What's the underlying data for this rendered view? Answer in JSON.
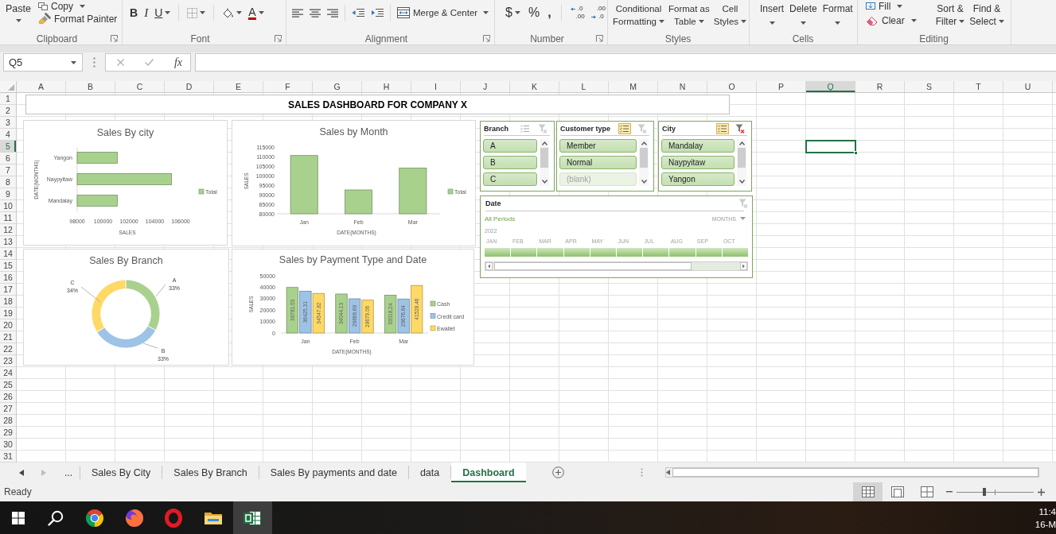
{
  "ribbon": {
    "clipboard": {
      "label": "Clipboard",
      "launcher": true,
      "paste": "Paste",
      "copy": "Copy",
      "format_painter": "Format Painter"
    },
    "font": {
      "label": "Font",
      "launcher": true,
      "bold": "B",
      "italic": "I",
      "underline": "U",
      "font_color": "A"
    },
    "alignment": {
      "label": "Alignment",
      "launcher": true,
      "merge": "Merge & Center"
    },
    "number": {
      "label": "Number",
      "launcher": true,
      "currency": "$",
      "percent": "%",
      "comma": ",",
      "increase_decimal": [
        ".0",
        ".00"
      ],
      "decrease_decimal": [
        ".00",
        ".0"
      ]
    },
    "styles": {
      "label": "Styles",
      "buttons": [
        [
          "Conditional",
          "Formatting"
        ],
        [
          "Format as",
          "Table"
        ],
        [
          "Cell",
          "Styles"
        ]
      ]
    },
    "cells": {
      "label": "Cells",
      "buttons": [
        "Insert",
        "Delete",
        "Format"
      ]
    },
    "editing": {
      "label": "Editing",
      "fill": "Fill",
      "clear": "Clear",
      "buttons": [
        [
          "Sort &",
          "Filter"
        ],
        [
          "Find &",
          "Select"
        ]
      ]
    }
  },
  "formula_bar": {
    "name_box": "Q5",
    "function_button": "fx"
  },
  "sheet": {
    "columns": [
      {
        "label": "A",
        "selected": false
      },
      {
        "label": "B",
        "selected": false
      },
      {
        "label": "C",
        "selected": false
      },
      {
        "label": "D",
        "selected": false
      },
      {
        "label": "E",
        "selected": false
      },
      {
        "label": "F",
        "selected": false
      },
      {
        "label": "G",
        "selected": false
      },
      {
        "label": "H",
        "selected": false
      },
      {
        "label": "I",
        "selected": false
      },
      {
        "label": "J",
        "selected": false
      },
      {
        "label": "K",
        "selected": false
      },
      {
        "label": "L",
        "selected": false
      },
      {
        "label": "M",
        "selected": false
      },
      {
        "label": "N",
        "selected": false
      },
      {
        "label": "O",
        "selected": false
      },
      {
        "label": "P",
        "selected": false
      },
      {
        "label": "Q",
        "selected": true
      },
      {
        "label": "R",
        "selected": false
      },
      {
        "label": "S",
        "selected": false
      },
      {
        "label": "T",
        "selected": false
      },
      {
        "label": "U",
        "selected": false
      }
    ],
    "rows": [
      {
        "label": "1",
        "selected": false
      },
      {
        "label": "2",
        "selected": false
      },
      {
        "label": "3",
        "selected": false
      },
      {
        "label": "4",
        "selected": false
      },
      {
        "label": "5",
        "selected": true
      },
      {
        "label": "6",
        "selected": false
      },
      {
        "label": "7",
        "selected": false
      },
      {
        "label": "8",
        "selected": false
      },
      {
        "label": "9",
        "selected": false
      },
      {
        "label": "10",
        "selected": false
      },
      {
        "label": "11",
        "selected": false
      },
      {
        "label": "12",
        "selected": false
      },
      {
        "label": "13",
        "selected": false
      },
      {
        "label": "14",
        "selected": false
      },
      {
        "label": "15",
        "selected": false
      },
      {
        "label": "16",
        "selected": false
      },
      {
        "label": "17",
        "selected": false
      },
      {
        "label": "18",
        "selected": false
      },
      {
        "label": "19",
        "selected": false
      },
      {
        "label": "20",
        "selected": false
      },
      {
        "label": "21",
        "selected": false
      },
      {
        "label": "22",
        "selected": false
      },
      {
        "label": "23",
        "selected": false
      },
      {
        "label": "24",
        "selected": false
      },
      {
        "label": "25",
        "selected": false
      },
      {
        "label": "26",
        "selected": false
      },
      {
        "label": "27",
        "selected": false
      },
      {
        "label": "28",
        "selected": false
      },
      {
        "label": "29",
        "selected": false
      },
      {
        "label": "30",
        "selected": false
      },
      {
        "label": "31",
        "selected": false
      }
    ],
    "title": "SALES DASHBOARD FOR COMPANY X"
  },
  "charts": [
    {
      "chart_data": {
        "type": "bar",
        "orientation": "horizontal",
        "title": "Sales By city",
        "xlabel": "SALES",
        "ylabel": "DATE(MONTHS)",
        "categories": [
          "Yangon",
          "Naypyitaw",
          "Mandalay"
        ],
        "series": [
          {
            "name": "Total",
            "color": "#a9d18e",
            "values": [
              101100,
              105300,
              101100
            ]
          }
        ],
        "xlim": [
          98000,
          106000
        ],
        "xticks": [
          98000,
          100000,
          102000,
          104000,
          106000
        ],
        "legend": "right"
      }
    },
    {
      "chart_data": {
        "type": "bar",
        "title": "Sales by Month",
        "xlabel": "DATE(MONTHS)",
        "ylabel": "SALES",
        "categories": [
          "Jan",
          "Feb",
          "Mar"
        ],
        "series": [
          {
            "name": "Total",
            "color": "#a9d18e",
            "values": [
              110800,
              92600,
              104200
            ]
          }
        ],
        "ylim": [
          80000,
          115000
        ],
        "yticks": [
          80000,
          85000,
          90000,
          95000,
          100000,
          105000,
          110000,
          115000
        ],
        "legend": "right"
      }
    },
    {
      "chart_data": {
        "type": "donut",
        "title": "Sales By Branch",
        "categories": [
          "A",
          "B",
          "C"
        ],
        "values": [
          33,
          33,
          34
        ],
        "colors": [
          "#a9d18e",
          "#9dc3e6",
          "#ffd966"
        ],
        "value_labels": [
          "33%",
          "33%",
          "34%"
        ]
      }
    },
    {
      "chart_data": {
        "type": "bar",
        "title": "Sales by Payment Type and Date",
        "xlabel": "DATE(MONTHS)",
        "ylabel": "SALES",
        "categories": [
          "Jan",
          "Feb",
          "Mar"
        ],
        "series": [
          {
            "name": "Cash",
            "color": "#a9d18e",
            "values": [
              39781.03,
              34044.13,
              33018.24
            ]
          },
          {
            "name": "Credit card",
            "color": "#9dc3e6",
            "values": [
              36425.31,
              29866.69,
              29676.64
            ]
          },
          {
            "name": "Ewallet",
            "color": "#ffd966",
            "values": [
              34547.82,
              28679.06,
              41528.46
            ]
          }
        ],
        "ylim": [
          0,
          50000
        ],
        "yticks": [
          0,
          10000,
          20000,
          30000,
          40000,
          50000
        ],
        "data_labels": true,
        "legend": "right"
      }
    }
  ],
  "slicers": [
    {
      "title": "Branch",
      "multi_select": false,
      "filtered": false,
      "items": [
        {
          "label": "A",
          "selected": true
        },
        {
          "label": "B",
          "selected": true
        },
        {
          "label": "C",
          "selected": true
        }
      ]
    },
    {
      "title": "Customer type",
      "multi_select": true,
      "filtered": false,
      "items": [
        {
          "label": "Member",
          "selected": true
        },
        {
          "label": "Normal",
          "selected": true
        },
        {
          "label": "(blank)",
          "selected": false
        }
      ]
    },
    {
      "title": "City",
      "multi_select": true,
      "filtered": true,
      "items": [
        {
          "label": "Mandalay",
          "selected": true
        },
        {
          "label": "Naypyitaw",
          "selected": true
        },
        {
          "label": "Yangon",
          "selected": true
        }
      ]
    }
  ],
  "timeline": {
    "title": "Date",
    "filtered": false,
    "period": "All Periods",
    "time_level": "MONTHS",
    "year": "2022",
    "months": [
      {
        "label": "JAN",
        "selected": true
      },
      {
        "label": "FEB",
        "selected": true
      },
      {
        "label": "MAR",
        "selected": true
      },
      {
        "label": "APR",
        "selected": true
      },
      {
        "label": "MAY",
        "selected": true
      },
      {
        "label": "JUN",
        "selected": true
      },
      {
        "label": "JUL",
        "selected": true
      },
      {
        "label": "AUG",
        "selected": true
      },
      {
        "label": "SEP",
        "selected": true
      },
      {
        "label": "OCT",
        "selected": true
      }
    ]
  },
  "sheet_tabs": {
    "more": "...",
    "tabs": [
      {
        "label": "Sales By City",
        "selected": false
      },
      {
        "label": "Sales By Branch",
        "selected": false
      },
      {
        "label": "Sales By payments and date",
        "selected": false
      },
      {
        "label": "data",
        "selected": false
      },
      {
        "label": "Dashboard",
        "selected": true
      }
    ]
  },
  "status_bar": {
    "status": "Ready",
    "views": [
      {
        "kind": "normal",
        "selected": true
      },
      {
        "kind": "layout",
        "selected": false
      },
      {
        "kind": "breaks",
        "selected": false
      }
    ],
    "zoom": {
      "level": 0.36
    }
  },
  "taskbar": {
    "apps": [
      {
        "kind": "start",
        "selected": false
      },
      {
        "kind": "search",
        "selected": false
      },
      {
        "kind": "wheel",
        "selected": false
      },
      {
        "kind": "fox",
        "selected": false
      },
      {
        "kind": "ring",
        "selected": false
      },
      {
        "kind": "folder",
        "selected": false
      },
      {
        "kind": "sheet",
        "selected": true
      }
    ],
    "clock": {
      "time": "11:4",
      "date": "16-M"
    }
  }
}
